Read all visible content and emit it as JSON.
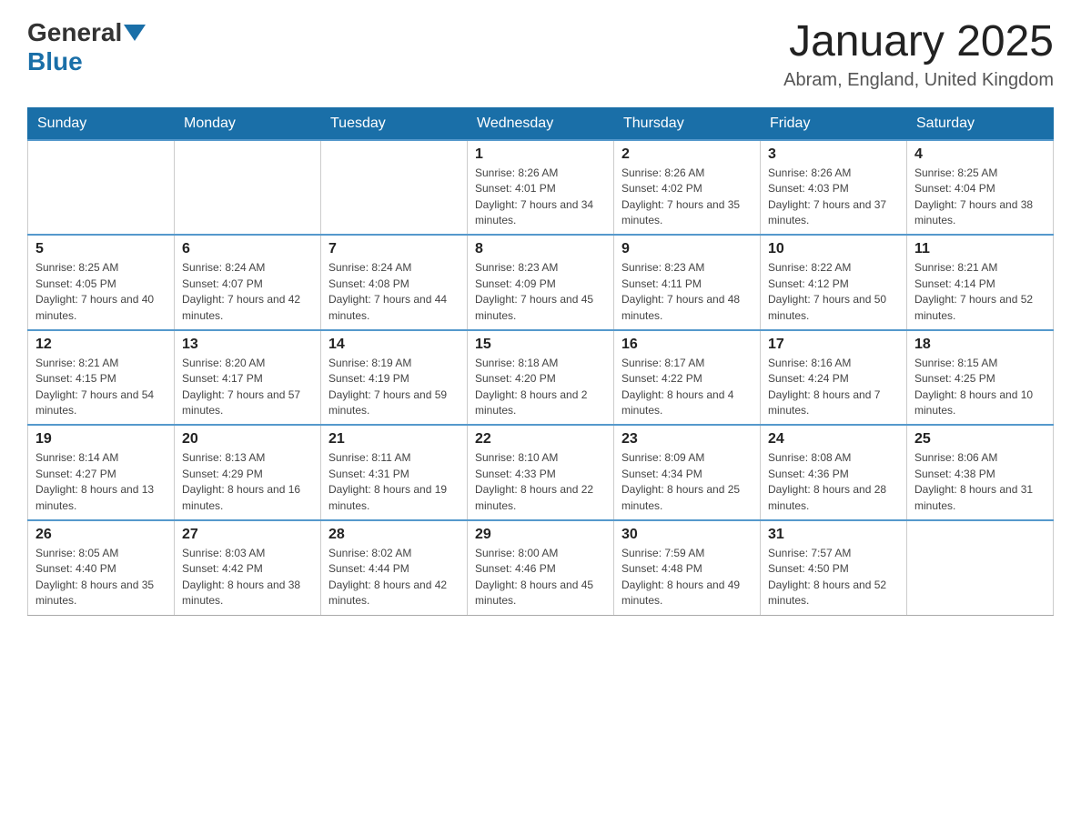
{
  "header": {
    "logo_general": "General",
    "logo_blue": "Blue",
    "month_title": "January 2025",
    "location": "Abram, England, United Kingdom"
  },
  "days_of_week": [
    "Sunday",
    "Monday",
    "Tuesday",
    "Wednesday",
    "Thursday",
    "Friday",
    "Saturday"
  ],
  "weeks": [
    [
      {
        "day": "",
        "sunrise": "",
        "sunset": "",
        "daylight": ""
      },
      {
        "day": "",
        "sunrise": "",
        "sunset": "",
        "daylight": ""
      },
      {
        "day": "",
        "sunrise": "",
        "sunset": "",
        "daylight": ""
      },
      {
        "day": "1",
        "sunrise": "Sunrise: 8:26 AM",
        "sunset": "Sunset: 4:01 PM",
        "daylight": "Daylight: 7 hours and 34 minutes."
      },
      {
        "day": "2",
        "sunrise": "Sunrise: 8:26 AM",
        "sunset": "Sunset: 4:02 PM",
        "daylight": "Daylight: 7 hours and 35 minutes."
      },
      {
        "day": "3",
        "sunrise": "Sunrise: 8:26 AM",
        "sunset": "Sunset: 4:03 PM",
        "daylight": "Daylight: 7 hours and 37 minutes."
      },
      {
        "day": "4",
        "sunrise": "Sunrise: 8:25 AM",
        "sunset": "Sunset: 4:04 PM",
        "daylight": "Daylight: 7 hours and 38 minutes."
      }
    ],
    [
      {
        "day": "5",
        "sunrise": "Sunrise: 8:25 AM",
        "sunset": "Sunset: 4:05 PM",
        "daylight": "Daylight: 7 hours and 40 minutes."
      },
      {
        "day": "6",
        "sunrise": "Sunrise: 8:24 AM",
        "sunset": "Sunset: 4:07 PM",
        "daylight": "Daylight: 7 hours and 42 minutes."
      },
      {
        "day": "7",
        "sunrise": "Sunrise: 8:24 AM",
        "sunset": "Sunset: 4:08 PM",
        "daylight": "Daylight: 7 hours and 44 minutes."
      },
      {
        "day": "8",
        "sunrise": "Sunrise: 8:23 AM",
        "sunset": "Sunset: 4:09 PM",
        "daylight": "Daylight: 7 hours and 45 minutes."
      },
      {
        "day": "9",
        "sunrise": "Sunrise: 8:23 AM",
        "sunset": "Sunset: 4:11 PM",
        "daylight": "Daylight: 7 hours and 48 minutes."
      },
      {
        "day": "10",
        "sunrise": "Sunrise: 8:22 AM",
        "sunset": "Sunset: 4:12 PM",
        "daylight": "Daylight: 7 hours and 50 minutes."
      },
      {
        "day": "11",
        "sunrise": "Sunrise: 8:21 AM",
        "sunset": "Sunset: 4:14 PM",
        "daylight": "Daylight: 7 hours and 52 minutes."
      }
    ],
    [
      {
        "day": "12",
        "sunrise": "Sunrise: 8:21 AM",
        "sunset": "Sunset: 4:15 PM",
        "daylight": "Daylight: 7 hours and 54 minutes."
      },
      {
        "day": "13",
        "sunrise": "Sunrise: 8:20 AM",
        "sunset": "Sunset: 4:17 PM",
        "daylight": "Daylight: 7 hours and 57 minutes."
      },
      {
        "day": "14",
        "sunrise": "Sunrise: 8:19 AM",
        "sunset": "Sunset: 4:19 PM",
        "daylight": "Daylight: 7 hours and 59 minutes."
      },
      {
        "day": "15",
        "sunrise": "Sunrise: 8:18 AM",
        "sunset": "Sunset: 4:20 PM",
        "daylight": "Daylight: 8 hours and 2 minutes."
      },
      {
        "day": "16",
        "sunrise": "Sunrise: 8:17 AM",
        "sunset": "Sunset: 4:22 PM",
        "daylight": "Daylight: 8 hours and 4 minutes."
      },
      {
        "day": "17",
        "sunrise": "Sunrise: 8:16 AM",
        "sunset": "Sunset: 4:24 PM",
        "daylight": "Daylight: 8 hours and 7 minutes."
      },
      {
        "day": "18",
        "sunrise": "Sunrise: 8:15 AM",
        "sunset": "Sunset: 4:25 PM",
        "daylight": "Daylight: 8 hours and 10 minutes."
      }
    ],
    [
      {
        "day": "19",
        "sunrise": "Sunrise: 8:14 AM",
        "sunset": "Sunset: 4:27 PM",
        "daylight": "Daylight: 8 hours and 13 minutes."
      },
      {
        "day": "20",
        "sunrise": "Sunrise: 8:13 AM",
        "sunset": "Sunset: 4:29 PM",
        "daylight": "Daylight: 8 hours and 16 minutes."
      },
      {
        "day": "21",
        "sunrise": "Sunrise: 8:11 AM",
        "sunset": "Sunset: 4:31 PM",
        "daylight": "Daylight: 8 hours and 19 minutes."
      },
      {
        "day": "22",
        "sunrise": "Sunrise: 8:10 AM",
        "sunset": "Sunset: 4:33 PM",
        "daylight": "Daylight: 8 hours and 22 minutes."
      },
      {
        "day": "23",
        "sunrise": "Sunrise: 8:09 AM",
        "sunset": "Sunset: 4:34 PM",
        "daylight": "Daylight: 8 hours and 25 minutes."
      },
      {
        "day": "24",
        "sunrise": "Sunrise: 8:08 AM",
        "sunset": "Sunset: 4:36 PM",
        "daylight": "Daylight: 8 hours and 28 minutes."
      },
      {
        "day": "25",
        "sunrise": "Sunrise: 8:06 AM",
        "sunset": "Sunset: 4:38 PM",
        "daylight": "Daylight: 8 hours and 31 minutes."
      }
    ],
    [
      {
        "day": "26",
        "sunrise": "Sunrise: 8:05 AM",
        "sunset": "Sunset: 4:40 PM",
        "daylight": "Daylight: 8 hours and 35 minutes."
      },
      {
        "day": "27",
        "sunrise": "Sunrise: 8:03 AM",
        "sunset": "Sunset: 4:42 PM",
        "daylight": "Daylight: 8 hours and 38 minutes."
      },
      {
        "day": "28",
        "sunrise": "Sunrise: 8:02 AM",
        "sunset": "Sunset: 4:44 PM",
        "daylight": "Daylight: 8 hours and 42 minutes."
      },
      {
        "day": "29",
        "sunrise": "Sunrise: 8:00 AM",
        "sunset": "Sunset: 4:46 PM",
        "daylight": "Daylight: 8 hours and 45 minutes."
      },
      {
        "day": "30",
        "sunrise": "Sunrise: 7:59 AM",
        "sunset": "Sunset: 4:48 PM",
        "daylight": "Daylight: 8 hours and 49 minutes."
      },
      {
        "day": "31",
        "sunrise": "Sunrise: 7:57 AM",
        "sunset": "Sunset: 4:50 PM",
        "daylight": "Daylight: 8 hours and 52 minutes."
      },
      {
        "day": "",
        "sunrise": "",
        "sunset": "",
        "daylight": ""
      }
    ]
  ]
}
